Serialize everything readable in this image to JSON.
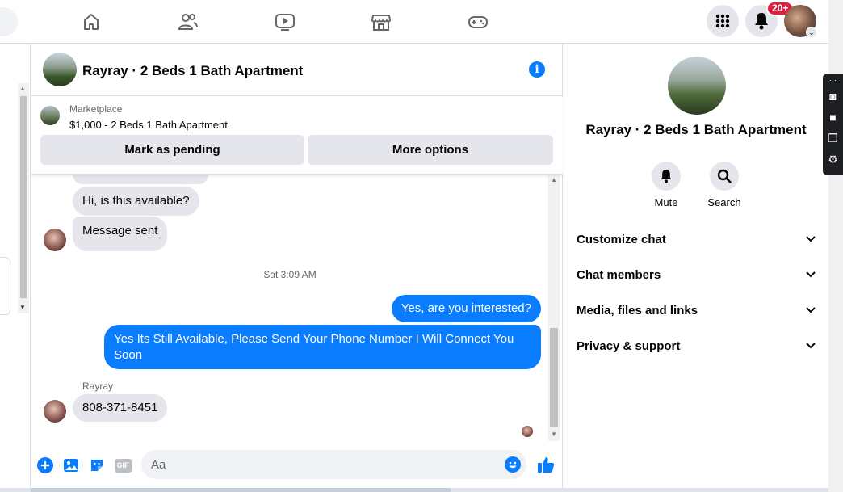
{
  "topbar": {
    "nav": [
      {
        "name": "home-icon"
      },
      {
        "name": "friends-icon"
      },
      {
        "name": "watch-icon"
      },
      {
        "name": "marketplace-icon"
      },
      {
        "name": "gaming-icon"
      }
    ],
    "menu_icon": "grid-menu-icon",
    "notifications_badge": "20+"
  },
  "chat": {
    "title": "Rayray · 2 Beds 1 Bath Apartment",
    "marketplace": {
      "label": "Marketplace",
      "listing": "$1,000 - 2 Beds 1 Bath Apartment",
      "mark_pending": "Mark as pending",
      "more_options": "More options"
    },
    "messages": {
      "m1": "Hi, is this available?",
      "m2": "Message sent",
      "timestamp": "Sat 3:09 AM",
      "m3": "Yes, are you interested?",
      "m4_line1": "Yes Its Still Available, Please Send Your Phone Number I Will Connect You",
      "m4_line2": "Soon",
      "sender": "Rayray",
      "m5": "808-371-8451"
    },
    "composer": {
      "placeholder": "Aa",
      "gif": "GIF"
    }
  },
  "details": {
    "title": "Rayray · 2 Beds 1 Bath Apartment",
    "mute": "Mute",
    "search": "Search",
    "sections": [
      "Customize chat",
      "Chat members",
      "Media, files and links",
      "Privacy & support"
    ]
  },
  "colors": {
    "accent": "#0a7cff",
    "bubble_in": "#e4e6eb",
    "badge": "#e41e3f"
  }
}
